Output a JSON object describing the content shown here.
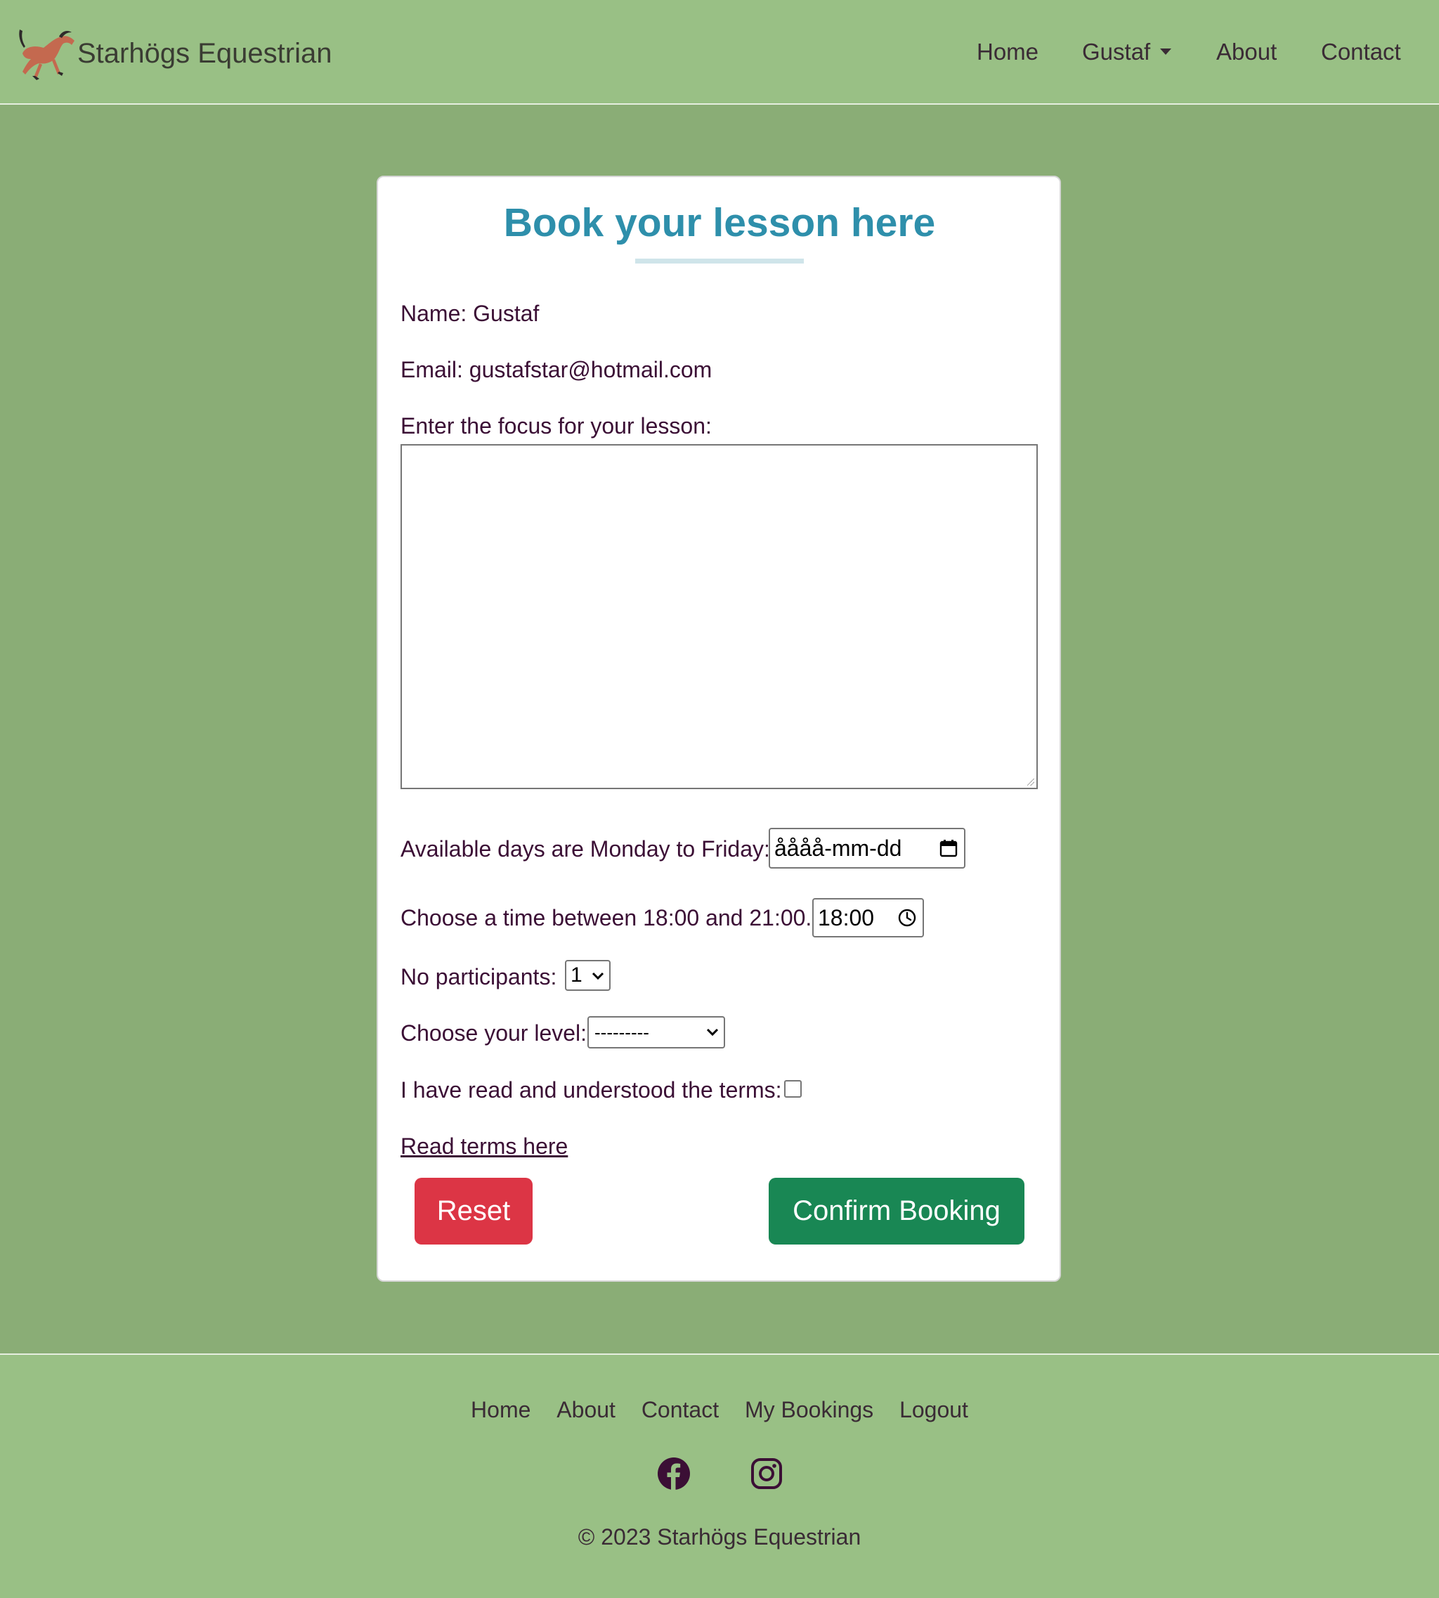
{
  "header": {
    "brand": "Starhögs Equestrian",
    "nav": {
      "home": "Home",
      "user": "Gustaf",
      "about": "About",
      "contact": "Contact"
    }
  },
  "form": {
    "title": "Book your lesson here",
    "name_line": "Name: Gustaf",
    "email_line": "Email: gustafstar@hotmail.com",
    "focus_label": "Enter the focus for your lesson:",
    "focus_value": "",
    "date_label": "Available days are Monday to Friday:",
    "date_value": "åååå-mm-dd",
    "time_label": "Choose a time between 18:00 and 21:00.",
    "time_value": "18:00",
    "participants_label": "No participants:",
    "participants_value": "1",
    "level_label": "Choose your level:",
    "level_value": "---------",
    "terms_label": "I have read and understood the terms:",
    "terms_checked": false,
    "terms_link": "Read terms here",
    "reset_label": "Reset",
    "confirm_label": "Confirm Booking"
  },
  "footer": {
    "links": [
      "Home",
      "About",
      "Contact",
      "My Bookings",
      "Logout"
    ],
    "social": [
      "facebook-icon",
      "instagram-icon"
    ],
    "copyright": "© 2023 Starhögs Equestrian"
  },
  "colors": {
    "page_background": "#8aad76",
    "header_footer": "#99c085",
    "title": "#2e8fab",
    "reset_button": "#dc3545",
    "confirm_button": "#198754",
    "text": "#3b0f35"
  }
}
